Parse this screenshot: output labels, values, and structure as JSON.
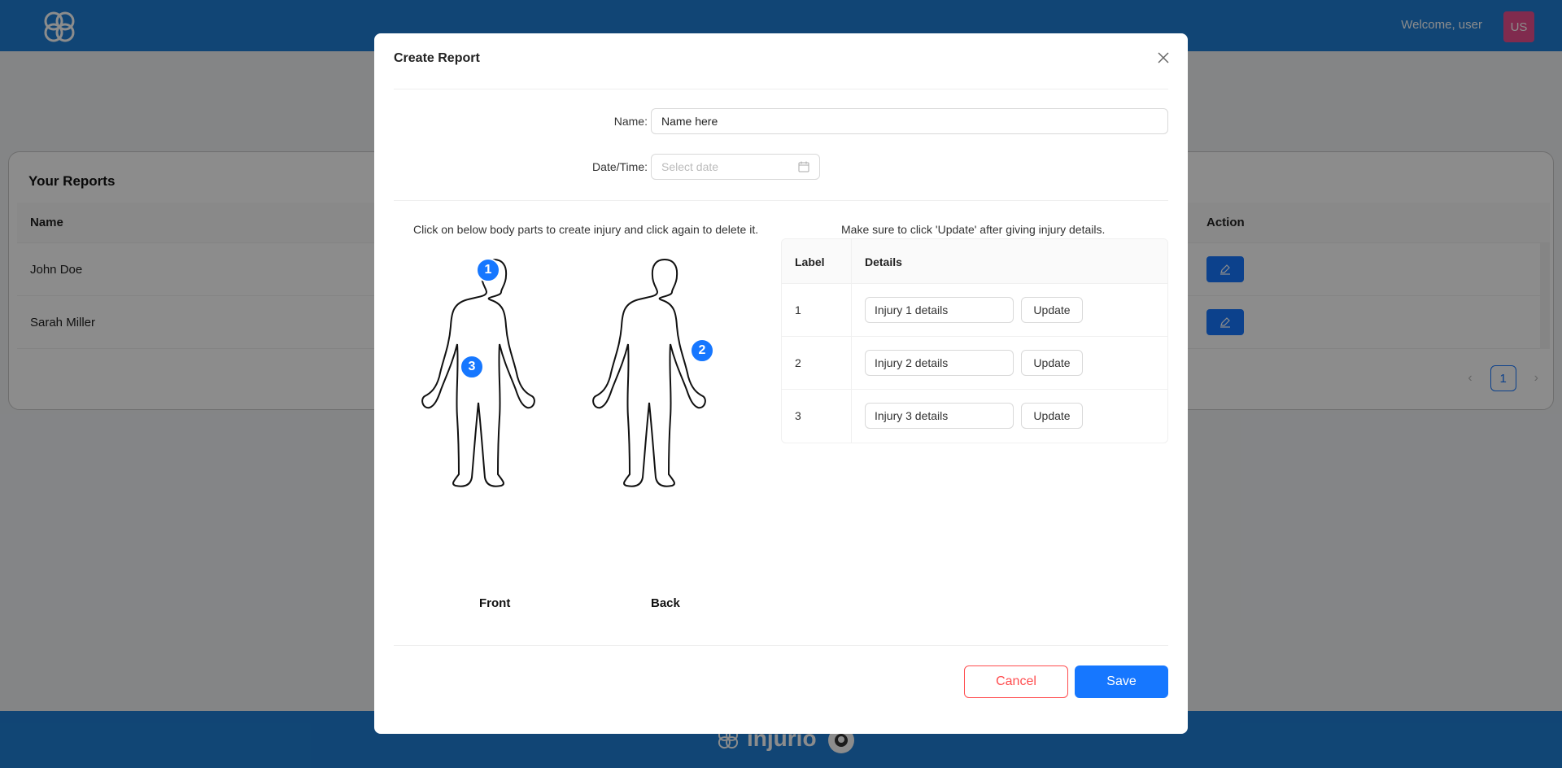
{
  "header": {
    "welcome": "Welcome, user",
    "avatar_initials": "US"
  },
  "reports": {
    "title": "Your Reports",
    "columns": {
      "name": "Name",
      "action": "Action"
    },
    "rows": [
      {
        "name": "John Doe"
      },
      {
        "name": "Sarah Miller"
      }
    ],
    "pagination": {
      "current_page": "1"
    }
  },
  "footer": {
    "brand": "injurio"
  },
  "modal": {
    "title": "Create Report",
    "name_label": "Name",
    "name_value": "Name here",
    "date_label": "Date/Time",
    "date_placeholder": "Select date",
    "left_instruction": "Click on below body parts to create injury and click again to delete it.",
    "right_instruction": "Make sure to click 'Update' after giving injury details.",
    "figures": {
      "front_label": "Front",
      "back_label": "Back"
    },
    "markers": [
      "1",
      "2",
      "3"
    ],
    "table": {
      "col_label": "Label",
      "col_details": "Details",
      "update_label": "Update",
      "rows": [
        {
          "label": "1",
          "details": "Injury 1 details"
        },
        {
          "label": "2",
          "details": "Injury 2 details"
        },
        {
          "label": "3",
          "details": "Injury 3 details"
        }
      ]
    },
    "cancel_label": "Cancel",
    "save_label": "Save"
  },
  "colors": {
    "brand_blue": "#1f7fd6",
    "primary": "#1677ff",
    "danger": "#ff4d4f",
    "avatar": "#ea4f8f"
  },
  "icons": [
    "logo-knot-icon",
    "close-icon",
    "calendar-icon",
    "edit-icon",
    "chevron-left-icon",
    "chevron-right-icon",
    "github-icon"
  ]
}
